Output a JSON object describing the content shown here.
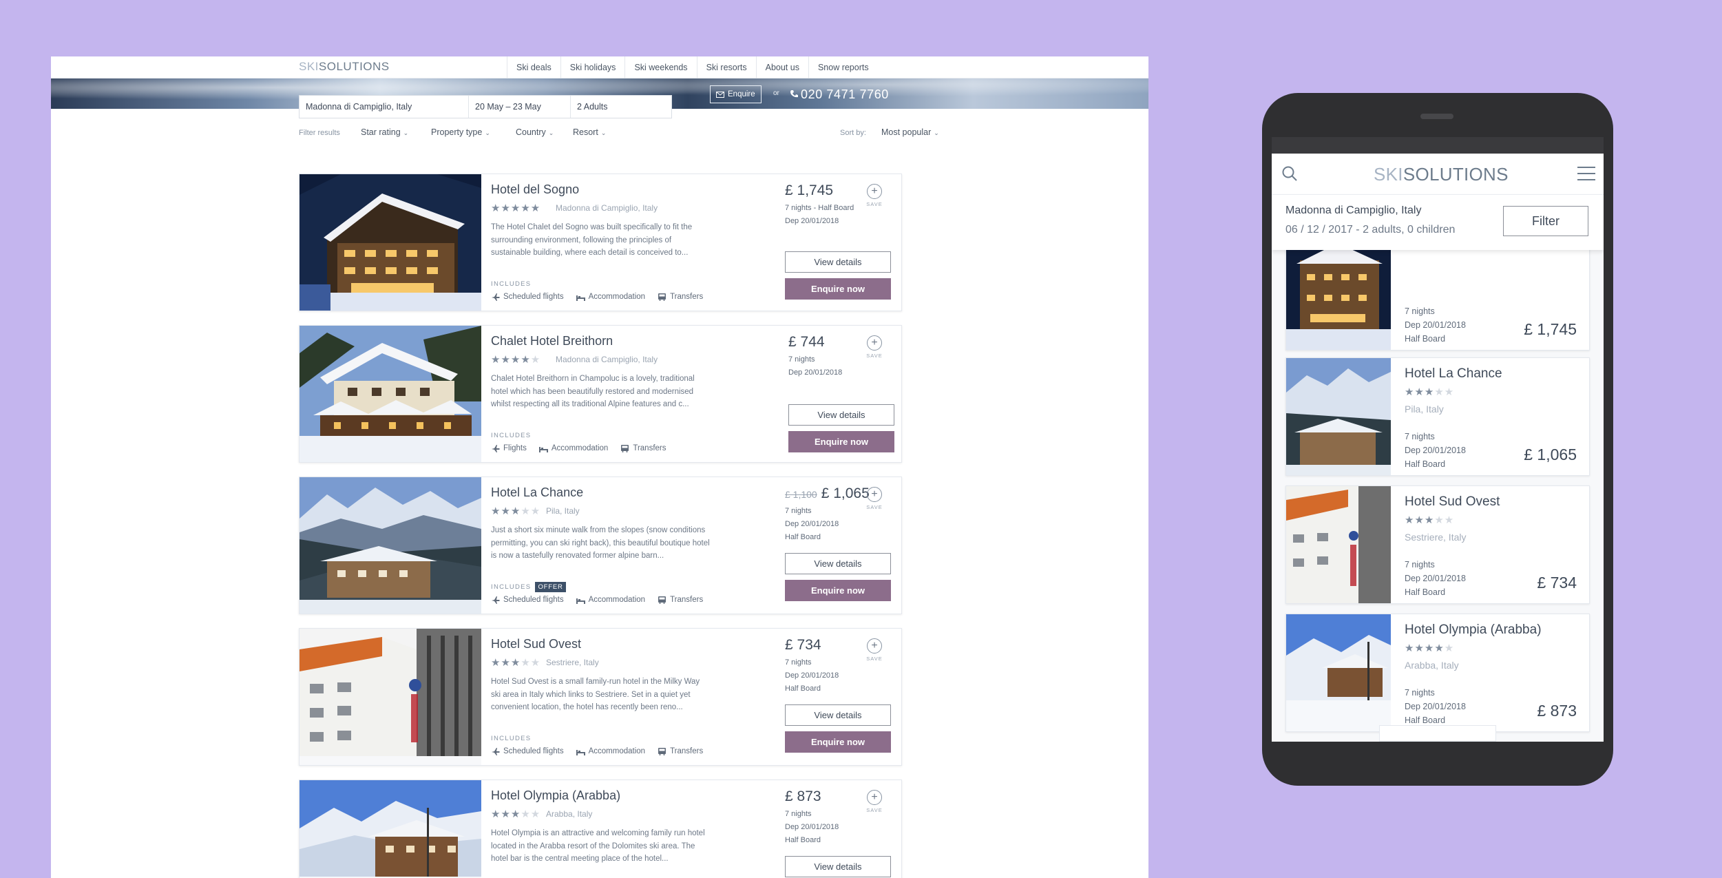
{
  "desktop": {
    "logo": {
      "part1": "SKI",
      "part2": "SOLUTIONS"
    },
    "nav": [
      "Ski deals",
      "Ski holidays",
      "Ski weekends",
      "Ski resorts",
      "About us",
      "Snow reports"
    ],
    "search": {
      "destination": "Madonna di Campiglio, Italy",
      "dates": "20 May – 23 May",
      "guests": "2 Adults"
    },
    "enquire_label": "Enquire",
    "or_label": "or",
    "phone": "020 7471 7760",
    "filters": {
      "label": "Filter results",
      "items": [
        "Star rating",
        "Property type",
        "Country",
        "Resort"
      ],
      "sort_label": "Sort by:",
      "sort_value": "Most popular"
    },
    "includes_label": "INCLUDES",
    "offer_label": "OFFER",
    "save_label": "SAVE",
    "view_label": "View details",
    "enquire_now_label": "Enquire now",
    "listings": [
      {
        "name": "Hotel del Sogno",
        "stars": 5,
        "location": "Madonna di Campiglio, Italy",
        "description": "The Hotel Chalet del Sogno was built specifically to fit the surrounding environment, following the principles of sustainable building, where each detail is conceived to...",
        "features": [
          "Scheduled flights",
          "Accommodation",
          "Transfers"
        ],
        "price": "£ 1,745",
        "old_price": "",
        "meta": [
          "7 nights - Half Board",
          "Dep 20/01/2018"
        ]
      },
      {
        "name": "Chalet Hotel Breithorn",
        "stars": 4,
        "location": "Madonna di Campiglio, Italy",
        "description": "Chalet Hotel Breithorn in Champoluc is a lovely, traditional hotel which has been beautifully restored and modernised whilst respecting all its traditional Alpine features and c...",
        "features": [
          "Flights",
          "Accommodation",
          "Transfers"
        ],
        "price": "£ 744",
        "old_price": "",
        "meta": [
          "7 nights",
          "Dep 20/01/2018"
        ]
      },
      {
        "name": "Hotel La Chance",
        "stars": 3,
        "location": "Pila, Italy",
        "description": "Just a short six minute walk from the slopes (snow conditions permitting, you can ski right back), this beautiful boutique hotel is now a tastefully renovated former alpine barn...",
        "features": [
          "Scheduled flights",
          "Accommodation",
          "Transfers"
        ],
        "price": "£ 1,065",
        "old_price": "£ 1,100",
        "meta": [
          "7 nights",
          "Dep 20/01/2018",
          "Half Board"
        ]
      },
      {
        "name": "Hotel Sud Ovest",
        "stars": 3,
        "location": "Sestriere, Italy",
        "description": "Hotel Sud Ovest is a small family-run hotel in the Milky Way ski area in Italy which links to Sestriere. Set in a quiet yet convenient location, the hotel has recently been reno...",
        "features": [
          "Scheduled flights",
          "Accommodation",
          "Transfers"
        ],
        "price": "£ 734",
        "old_price": "",
        "meta": [
          "7 nights",
          "Dep 20/01/2018",
          "Half Board"
        ]
      },
      {
        "name": "Hotel Olympia (Arabba)",
        "stars": 3,
        "location": "Arabba, Italy",
        "description": "Hotel Olympia is an attractive and welcoming family run hotel located in the Arabba resort of the Dolomites ski area. The hotel bar is the central meeting place of the hotel...",
        "features": [],
        "price": "£ 873",
        "old_price": "",
        "meta": [
          "7 nights",
          "Dep 20/01/2018",
          "Half Board"
        ]
      }
    ]
  },
  "mobile": {
    "logo": {
      "part1": "SKI",
      "part2": "SOLUTIONS"
    },
    "location": "Madonna di Campiglio, Italy",
    "dates_guests": "06 / 12 / 2017 - 2 adults, 0 children",
    "filter_label": "Filter",
    "cards": [
      {
        "name": "",
        "stars": 0,
        "location": "",
        "meta": [
          "7 nights",
          "Dep 20/01/2018",
          "Half Board"
        ],
        "price": "£ 1,745"
      },
      {
        "name": "Hotel La Chance",
        "stars": 3,
        "location": "Pila, Italy",
        "meta": [
          "7 nights",
          "Dep 20/01/2018",
          "Half Board"
        ],
        "price": "£ 1,065"
      },
      {
        "name": "Hotel Sud Ovest",
        "stars": 3,
        "location": "Sestriere, Italy",
        "meta": [
          "7 nights",
          "Dep 20/01/2018",
          "Half Board"
        ],
        "price": "£ 734"
      },
      {
        "name": "Hotel Olympia (Arabba)",
        "stars": 4,
        "location": "Arabba, Italy",
        "meta": [
          "7 nights",
          "Dep 20/01/2018",
          "Half Board"
        ],
        "price": "£ 873"
      }
    ]
  },
  "colors": {
    "background": "#c4b5ee",
    "accent_button": "#8c6d8b",
    "text_dark": "#3f4a59",
    "device": "#2f2f31"
  }
}
